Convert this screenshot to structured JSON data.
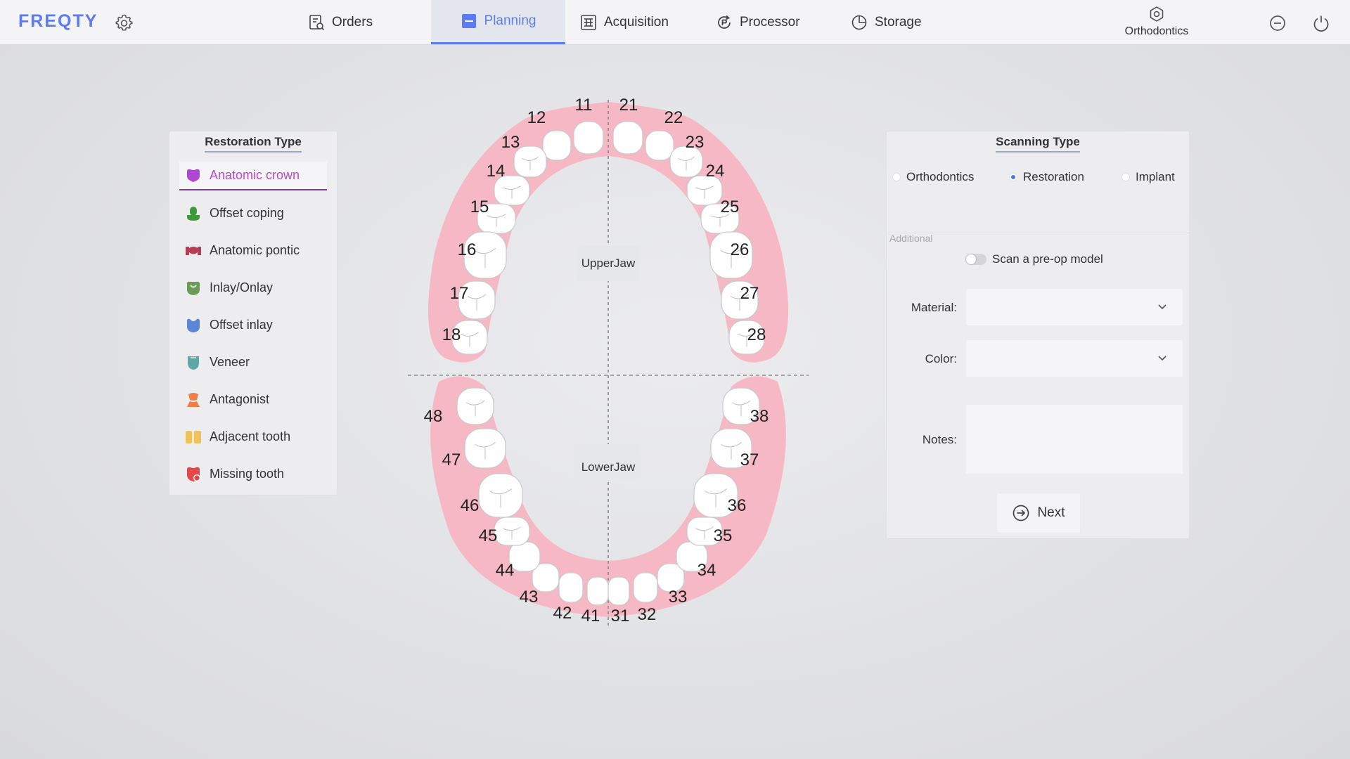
{
  "app": {
    "logo": "FREQTY"
  },
  "nav": {
    "tabs": [
      {
        "label": "Orders",
        "icon": "orders-icon"
      },
      {
        "label": "Planning",
        "icon": "planning-icon",
        "active": true
      },
      {
        "label": "Acquisition",
        "icon": "acquisition-icon"
      },
      {
        "label": "Processor",
        "icon": "processor-icon"
      },
      {
        "label": "Storage",
        "icon": "storage-icon"
      }
    ],
    "mode": "Orthodontics"
  },
  "restoration": {
    "title": "Restoration Type",
    "items": [
      {
        "label": "Anatomic crown",
        "icon": "crown-icon",
        "color": "#b046d4",
        "active": true
      },
      {
        "label": "Offset coping",
        "icon": "coping-icon",
        "color": "#3f9a3c"
      },
      {
        "label": "Anatomic pontic",
        "icon": "pontic-icon",
        "color": "#b43d57"
      },
      {
        "label": "Inlay/Onlay",
        "icon": "inlay-onlay-icon",
        "color": "#6c9b58"
      },
      {
        "label": "Offset inlay",
        "icon": "offset-inlay-icon",
        "color": "#5b86d6"
      },
      {
        "label": "Veneer",
        "icon": "veneer-icon",
        "color": "#5fa6a6"
      },
      {
        "label": "Antagonist",
        "icon": "antagonist-icon",
        "color": "#ef7f45"
      },
      {
        "label": "Adjacent tooth",
        "icon": "adjacent-tooth-icon",
        "color": "#f2c25a"
      },
      {
        "label": "Missing tooth",
        "icon": "missing-tooth-icon",
        "color": "#e2474a"
      }
    ]
  },
  "chart": {
    "upper_label": "UpperJaw",
    "lower_label": "LowerJaw",
    "upper_right": [
      "11",
      "12",
      "13",
      "14",
      "15",
      "16",
      "17",
      "18"
    ],
    "upper_left": [
      "21",
      "22",
      "23",
      "24",
      "25",
      "26",
      "27",
      "28"
    ],
    "lower_left": [
      "31",
      "32",
      "33",
      "34",
      "35",
      "36",
      "37",
      "38"
    ],
    "lower_right": [
      "41",
      "42",
      "43",
      "44",
      "45",
      "46",
      "47",
      "48"
    ],
    "gum_color": "#f5b8c4"
  },
  "scanning": {
    "title": "Scanning Type",
    "options": [
      {
        "label": "Orthodontics",
        "selected": false
      },
      {
        "label": "Restoration",
        "selected": true
      },
      {
        "label": "Implant",
        "selected": false
      }
    ],
    "additional_label": "Additional",
    "preop_label": "Scan a pre-op model",
    "material_label": "Material:",
    "color_label": "Color:",
    "notes_label": "Notes:",
    "next_label": "Next"
  },
  "colors": {
    "accent": "#5b7cf5",
    "radio": "#4a78e8"
  }
}
